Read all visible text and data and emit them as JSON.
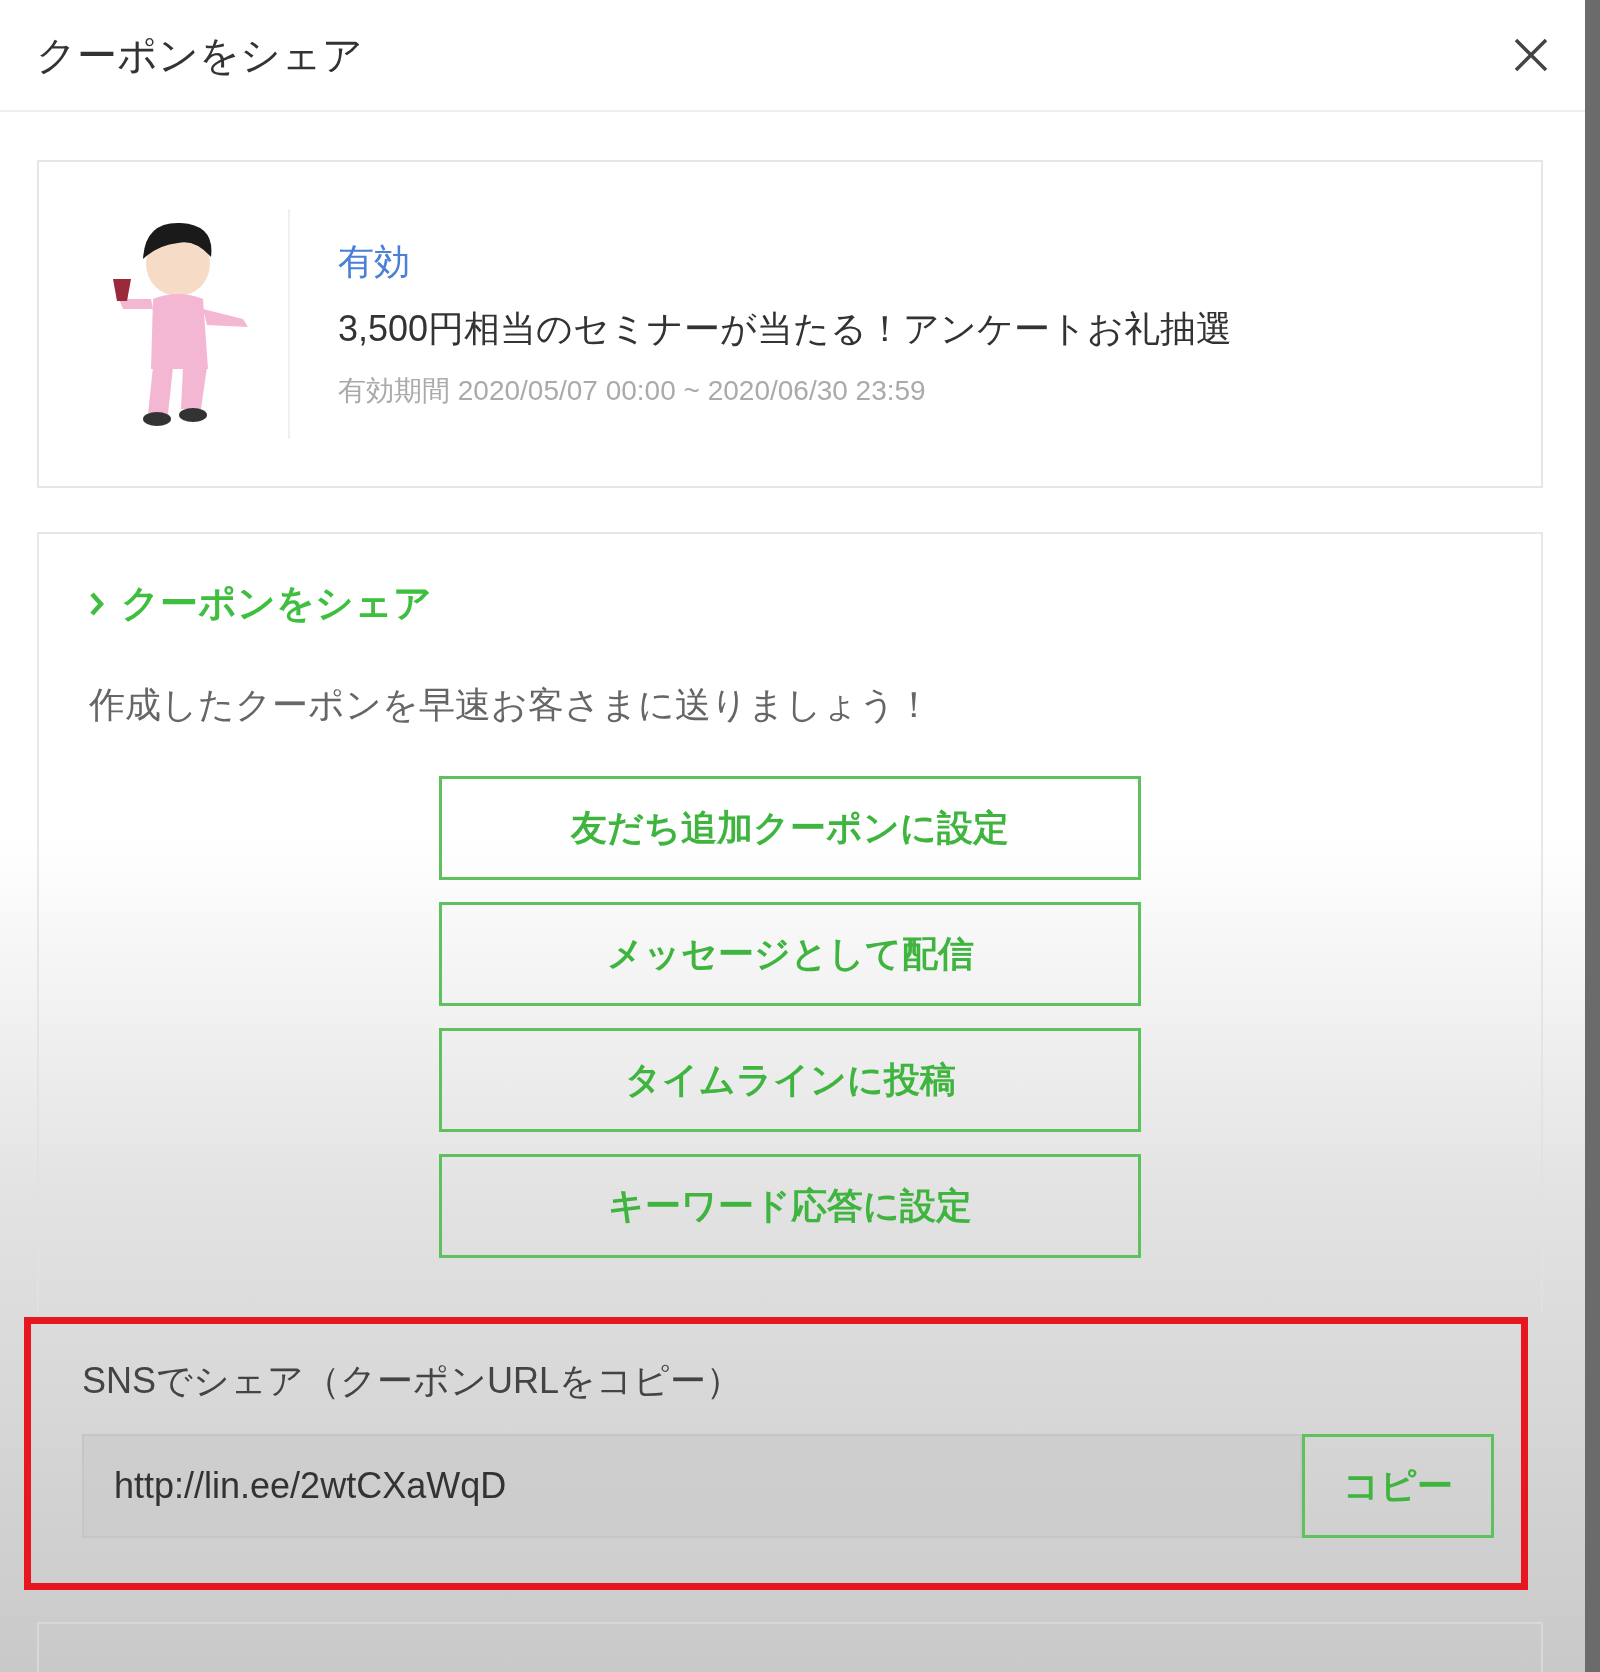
{
  "dialog": {
    "title": "クーポンをシェア"
  },
  "coupon": {
    "status": "有効",
    "title": "3,500円相当のセミナーが当たる！アンケートお礼抽選",
    "validity": "有効期間 2020/05/07 00:00 ~ 2020/06/30 23:59"
  },
  "share": {
    "heading": "クーポンをシェア",
    "description": "作成したクーポンを早速お客さまに送りましょう！",
    "buttons": [
      {
        "label": "友だち追加クーポンに設定"
      },
      {
        "label": "メッセージとして配信"
      },
      {
        "label": "タイムラインに投稿"
      },
      {
        "label": "キーワード応答に設定"
      }
    ]
  },
  "sns": {
    "label": "SNSでシェア（クーポンURLをコピー）",
    "url": "http://lin.ee/2wtCXaWqD",
    "copy_button": "コピー",
    "highlighted": true
  }
}
